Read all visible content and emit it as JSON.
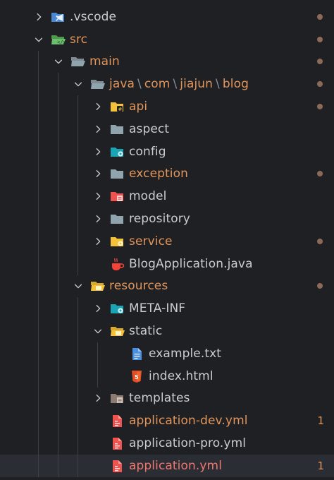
{
  "explorer": {
    "items": [
      {
        "label": ".vscode",
        "icon": "vscode-folder-icon",
        "expanded": false,
        "color": "normal"
      },
      {
        "label": "src",
        "icon": "src-folder-icon",
        "expanded": true,
        "color": "orange"
      },
      {
        "label": "main",
        "icon": "folder-open-icon",
        "expanded": true,
        "color": "orange"
      },
      {
        "path": [
          "java",
          "com",
          "jiajun",
          "blog"
        ],
        "separator": "\\",
        "icon": "folder-open-icon",
        "expanded": true,
        "color": "orange"
      },
      {
        "label": "api",
        "icon": "api-folder-icon",
        "expanded": false,
        "color": "orange"
      },
      {
        "label": "aspect",
        "icon": "folder-icon",
        "expanded": false,
        "color": "normal"
      },
      {
        "label": "config",
        "icon": "config-folder-icon",
        "expanded": false,
        "color": "normal"
      },
      {
        "label": "exception",
        "icon": "folder-icon",
        "expanded": false,
        "color": "orange"
      },
      {
        "label": "model",
        "icon": "model-folder-icon",
        "expanded": false,
        "color": "normal"
      },
      {
        "label": "repository",
        "icon": "folder-icon",
        "expanded": false,
        "color": "normal"
      },
      {
        "label": "service",
        "icon": "service-folder-icon",
        "expanded": false,
        "color": "orange"
      },
      {
        "label": "BlogApplication.java",
        "icon": "java-file-icon",
        "color": "normal"
      },
      {
        "label": "resources",
        "icon": "resources-folder-icon",
        "expanded": true,
        "color": "orange"
      },
      {
        "label": "META-INF",
        "icon": "config-folder-icon",
        "expanded": false,
        "color": "normal"
      },
      {
        "label": "static",
        "icon": "static-folder-icon",
        "expanded": true,
        "color": "normal"
      },
      {
        "label": "example.txt",
        "icon": "text-file-icon",
        "color": "normal"
      },
      {
        "label": "index.html",
        "icon": "html-file-icon",
        "color": "normal"
      },
      {
        "label": "templates",
        "icon": "templates-folder-icon",
        "expanded": false,
        "color": "normal"
      },
      {
        "label": "application-dev.yml",
        "icon": "yaml-file-icon",
        "color": "orange",
        "badge": "1"
      },
      {
        "label": "application-pro.yml",
        "icon": "yaml-file-icon",
        "color": "normal"
      },
      {
        "label": "application.yml",
        "icon": "yaml-file-icon",
        "color": "red",
        "badge": "1"
      }
    ]
  },
  "colors": {
    "background": "#1e2024",
    "selected_row": "#2a2d33",
    "modified": "#e2955a",
    "error": "#f0776e",
    "folder": "#90a4ae",
    "folder_open": "#90a4ae"
  }
}
